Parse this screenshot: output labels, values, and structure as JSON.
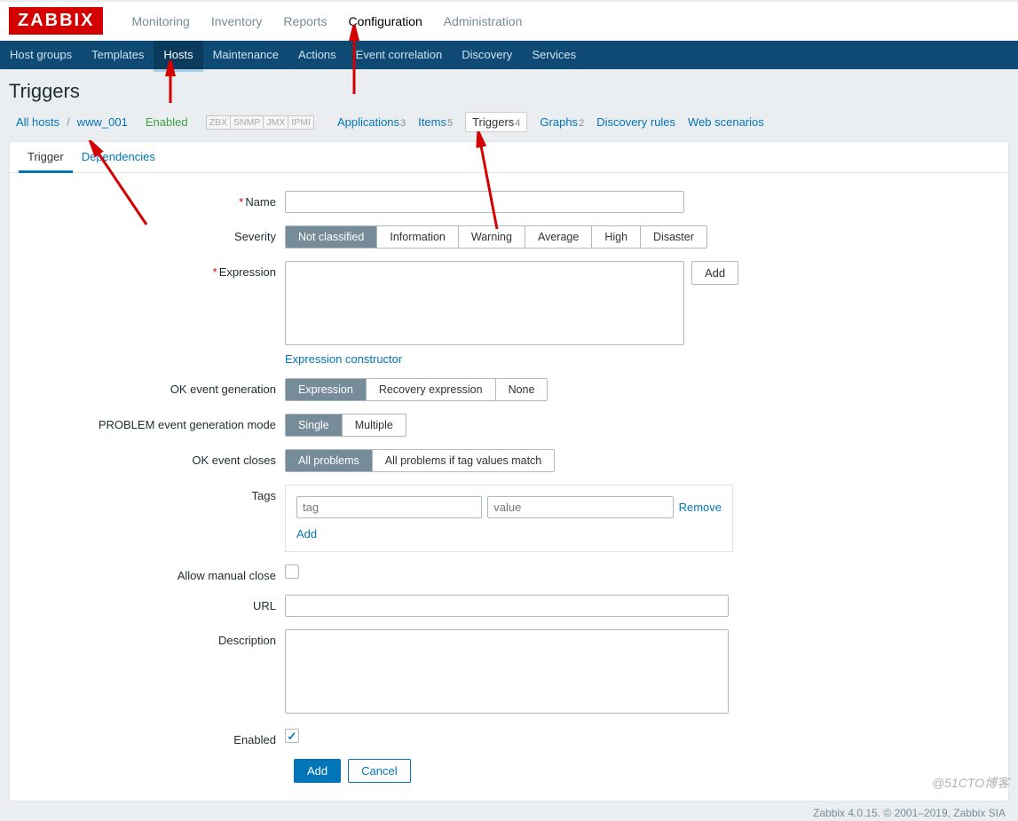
{
  "logo": "ZABBIX",
  "top_nav": {
    "monitoring": "Monitoring",
    "inventory": "Inventory",
    "reports": "Reports",
    "configuration": "Configuration",
    "administration": "Administration"
  },
  "sub_nav": {
    "host_groups": "Host groups",
    "templates": "Templates",
    "hosts": "Hosts",
    "maintenance": "Maintenance",
    "actions": "Actions",
    "event_correlation": "Event correlation",
    "discovery": "Discovery",
    "services": "Services"
  },
  "page_title": "Triggers",
  "breadcrumb": {
    "all_hosts": "All hosts",
    "host": "www_001",
    "status": "Enabled",
    "badges": {
      "zbx": "ZBX",
      "snmp": "SNMP",
      "jmx": "JMX",
      "ipmi": "IPMI"
    }
  },
  "host_nav": {
    "applications": {
      "label": "Applications",
      "count": "3"
    },
    "items": {
      "label": "Items",
      "count": "5"
    },
    "triggers": {
      "label": "Triggers",
      "count": "4"
    },
    "graphs": {
      "label": "Graphs",
      "count": "2"
    },
    "discovery": {
      "label": "Discovery rules"
    },
    "web": {
      "label": "Web scenarios"
    }
  },
  "tabs": {
    "trigger": "Trigger",
    "dependencies": "Dependencies"
  },
  "form": {
    "name_label": "Name",
    "name_value": "",
    "severity_label": "Severity",
    "severity_opts": {
      "nc": "Not classified",
      "info": "Information",
      "warn": "Warning",
      "avg": "Average",
      "high": "High",
      "dis": "Disaster"
    },
    "expression_label": "Expression",
    "expression_value": "",
    "add_btn": "Add",
    "expr_constructor": "Expression constructor",
    "ok_event_gen_label": "OK event generation",
    "ok_event_gen_opts": {
      "expr": "Expression",
      "rec": "Recovery expression",
      "none": "None"
    },
    "problem_mode_label": "PROBLEM event generation mode",
    "problem_mode_opts": {
      "single": "Single",
      "multiple": "Multiple"
    },
    "ok_closes_label": "OK event closes",
    "ok_closes_opts": {
      "all": "All problems",
      "tag": "All problems if tag values match"
    },
    "tags_label": "Tags",
    "tag_placeholder": "tag",
    "value_placeholder": "value",
    "remove": "Remove",
    "add_link": "Add",
    "allow_manual_label": "Allow manual close",
    "url_label": "URL",
    "url_value": "",
    "description_label": "Description",
    "description_value": "",
    "enabled_label": "Enabled",
    "submit": "Add",
    "cancel": "Cancel"
  },
  "footer": "Zabbix 4.0.15. © 2001–2019, Zabbix SIA",
  "watermark": "@51CTO博客"
}
